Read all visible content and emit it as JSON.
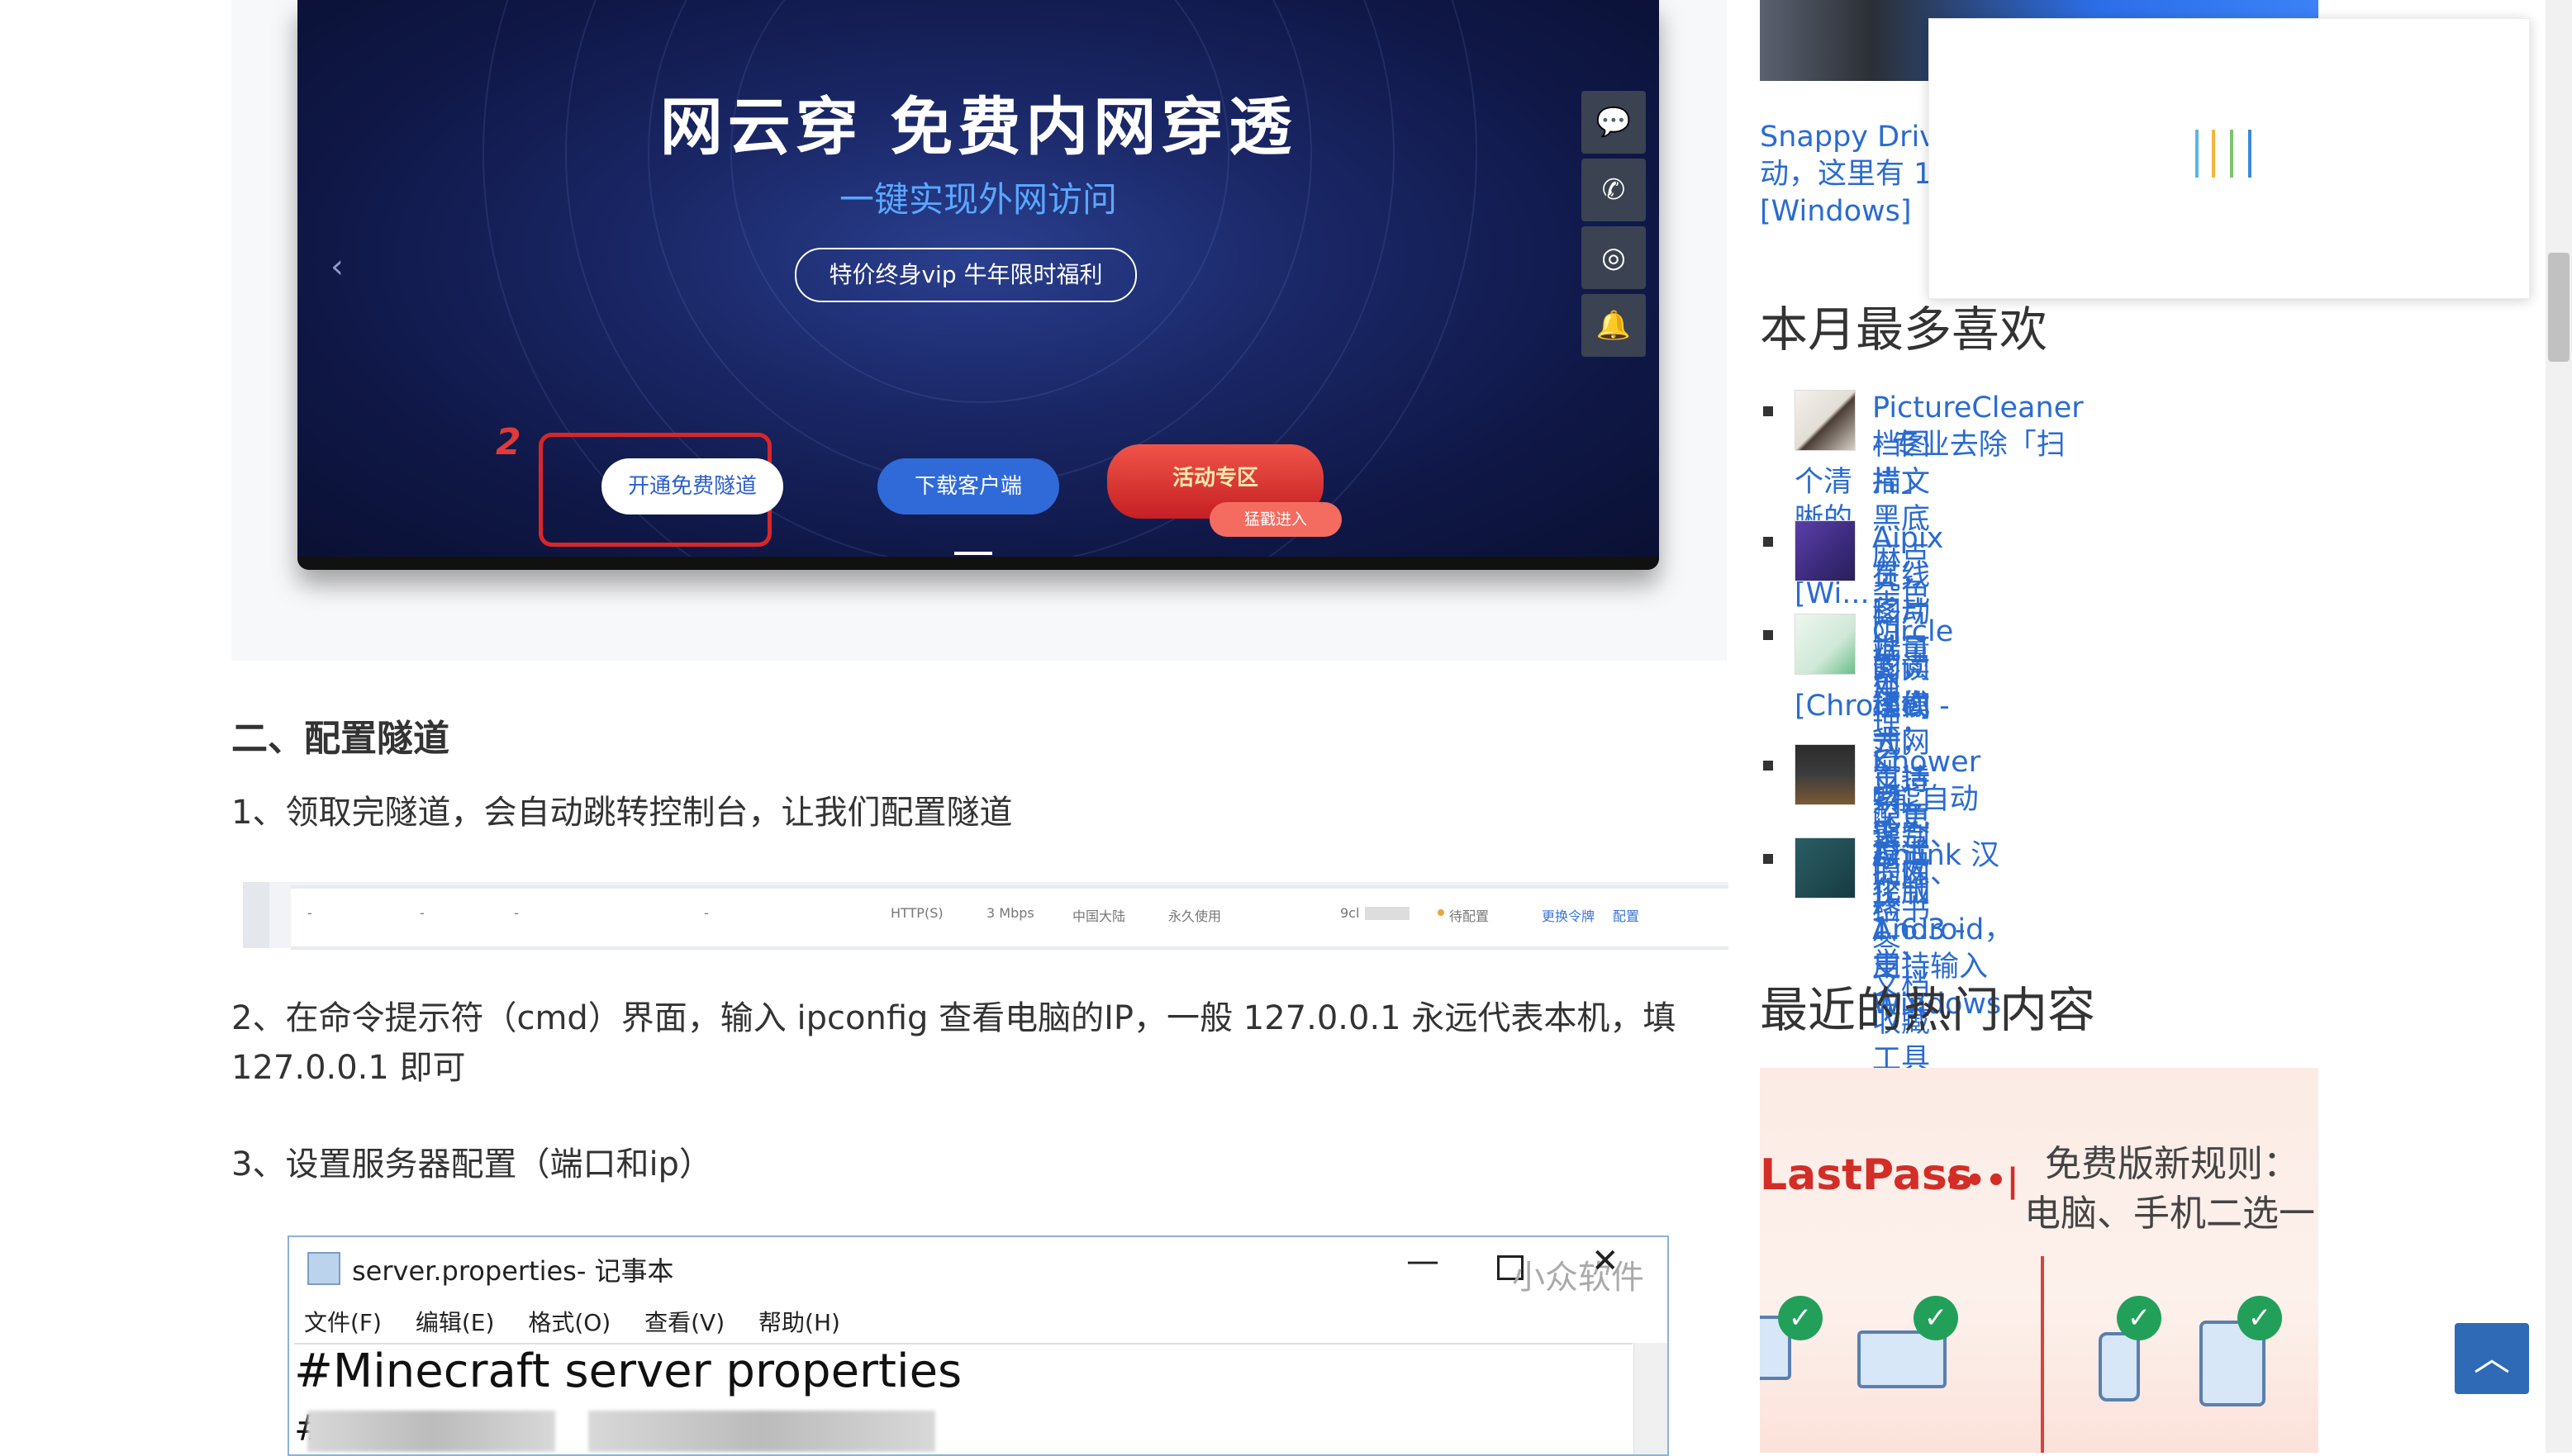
{
  "hero": {
    "title": "网云穿 免费内网穿透",
    "subtitle": "一键实现外网访问",
    "pill": "特价终身vip 牛年限时福利",
    "step_number": "2",
    "btn_free": "开通免费隧道",
    "btn_download": "下载客户端",
    "btn_activity": "活动专区",
    "btn_activity_sub": "猛戳进入",
    "side_icons": [
      "chat-icon",
      "phone-icon",
      "wechat-icon",
      "bell-icon"
    ]
  },
  "article": {
    "section_heading": "二、配置隧道",
    "step1": "1、领取完隧道，会自动跳转控制台，让我们配置隧道",
    "tunnel_row": {
      "protocol": "HTTP(S)",
      "bandwidth": "3 Mbps",
      "region": "中国大陆",
      "duration": "永久使用",
      "id_prefix": "9cl",
      "status": "待配置",
      "action_change": "更换令牌",
      "action_config": "配置"
    },
    "step2_line1": "2、在命令提示符（cmd）界面，输入 ipconfig 查看电脑的IP，一般 127.0.0.1 永远代表本机，填",
    "step2_line2": "127.0.0.1 即可",
    "step3": "3、设置服务器配置（端口和ip）",
    "notepad": {
      "title": "server.properties- 记事本",
      "watermark": "小众软件",
      "menu": [
        "文件(F)",
        "编辑(E)",
        "格式(O)",
        "查看(V)",
        "帮助(H)"
      ],
      "line1": "#Minecraft server properties",
      "line2_prefix": "#"
    }
  },
  "sidebar": {
    "top_link_line1": "Snappy Driv",
    "top_link_line2": "动，这里有 1",
    "top_link_line3": "[Windows]",
    "month_heading": "本月最多喜欢",
    "items": [
      {
        "line1": "PictureCleaner - 专业去除「扫描文",
        "line2": "档图片」黑底麻点杂色阴影，还你一",
        "line3": "个清晰的文本[Wi..."
      },
      {
        "line1": "Aipix 在线图片批量处理，流畅、连",
        "line2": "贯，移动端可用"
      },
      {
        "line1": "Circle 阅读模式 - 为网页适配更舒适",
        "line2": "的阅读模式，支持深色模式",
        "line3": "[Chrome]"
      },
      {
        "line1": "Knower - 能自动识别、提炼、检",
        "line2": "索、聚合的网络书签、文档收藏工具"
      },
      {
        "line1": "Anlink 汉化版 1.6.3 - 用 Windows",
        "line2": "控制 Android，支持输入中文"
      }
    ],
    "hot_heading": "最近的热门内容",
    "hot_image": {
      "brand": "LastPass",
      "brand_dots": "•••|",
      "caption_line1": "免费版新规则：",
      "caption_line2": "电脑、手机二选一"
    }
  },
  "colors": {
    "link": "#2a6bd1",
    "hero_bg": "#1a2766",
    "accent_red": "#d9262b",
    "back_to_top": "#2f6ab6"
  }
}
